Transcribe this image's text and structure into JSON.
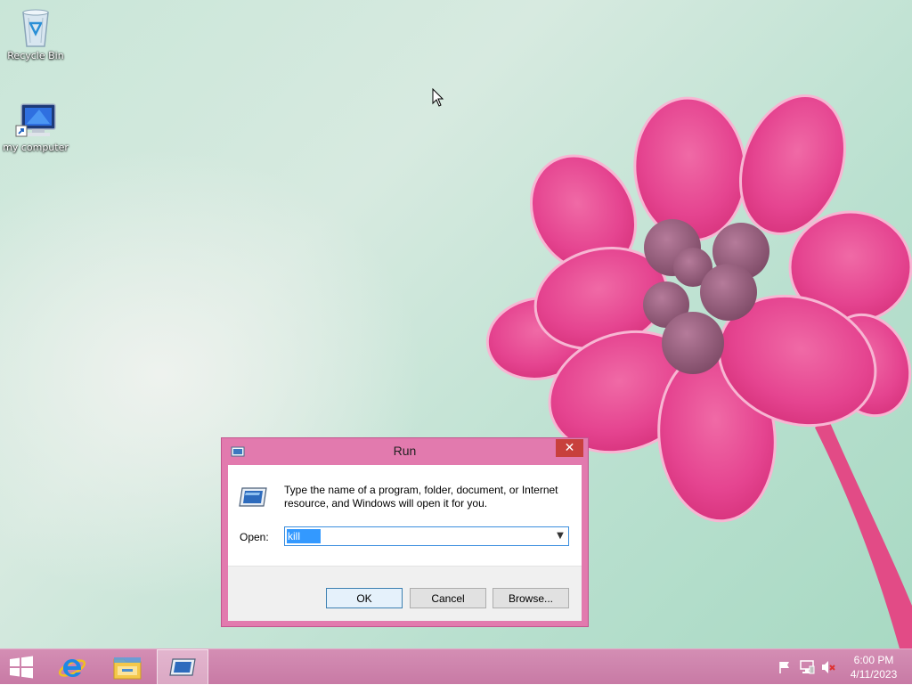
{
  "desktop": {
    "icons": [
      {
        "label": "Recycle Bin",
        "icon": "recycle-bin-icon"
      },
      {
        "label": "my computer",
        "icon": "computer-shortcut-icon"
      }
    ]
  },
  "run_dialog": {
    "title": "Run",
    "close_label": "✕",
    "description": "Type the name of a program, folder, document, or Internet resource, and Windows will open it for you.",
    "open_label": "Open:",
    "open_value": "kill",
    "ok_label": "OK",
    "cancel_label": "Cancel",
    "browse_label": "Browse..."
  },
  "taskbar": {
    "pinned": [
      {
        "icon": "windows-start-icon"
      },
      {
        "icon": "internet-explorer-icon"
      },
      {
        "icon": "file-explorer-icon"
      },
      {
        "icon": "run-app-icon"
      }
    ],
    "tray": {
      "icons": [
        "action-center-flag-icon",
        "network-icon",
        "volume-muted-icon"
      ],
      "time": "6:00 PM",
      "date": "4/11/2023"
    }
  },
  "colors": {
    "accent": "#e27aae",
    "taskbar": "#cc80aa",
    "close_button": "#c8403c",
    "selection": "#3399ff"
  }
}
